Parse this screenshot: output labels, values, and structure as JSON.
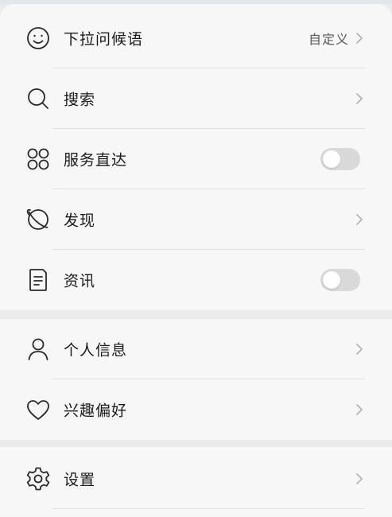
{
  "settings": {
    "group1": [
      {
        "label": "下拉问候语",
        "value": "自定义",
        "icon": "smiley-icon",
        "control": "chevron"
      },
      {
        "label": "搜索",
        "icon": "search-icon",
        "control": "chevron"
      },
      {
        "label": "服务直达",
        "icon": "grid-dots-icon",
        "control": "toggle",
        "on": false
      },
      {
        "label": "发现",
        "icon": "planet-icon",
        "control": "chevron"
      },
      {
        "label": "资讯",
        "icon": "document-icon",
        "control": "toggle",
        "on": false
      }
    ],
    "group2": [
      {
        "label": "个人信息",
        "icon": "person-icon",
        "control": "chevron"
      },
      {
        "label": "兴趣偏好",
        "icon": "heart-icon",
        "control": "chevron"
      }
    ],
    "group3": [
      {
        "label": "设置",
        "icon": "gear-icon",
        "control": "chevron"
      }
    ]
  },
  "colors": {
    "background": "#ebebeb",
    "card": "#f7f7f7",
    "toggle_off": "#d9d9d9",
    "text": "#1b1b1b",
    "secondary_text": "#585858"
  }
}
